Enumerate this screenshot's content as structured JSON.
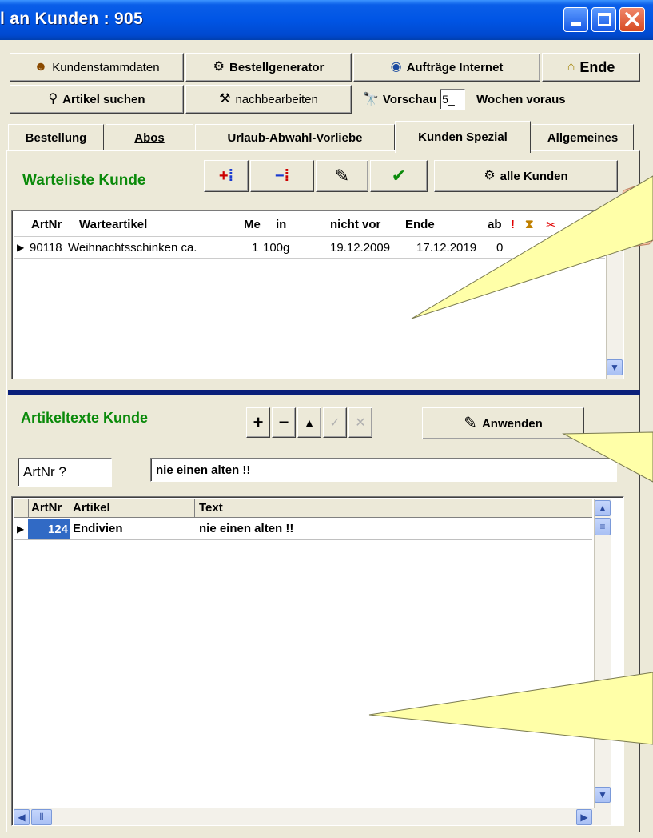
{
  "window": {
    "title": "l an Kunden :  905"
  },
  "toolbar": {
    "row1": [
      {
        "label": "Kundenstammdaten",
        "icon": "person-search-icon"
      },
      {
        "label": "Bestellgenerator",
        "icon": "gears-icon"
      },
      {
        "label": "Aufträge Internet",
        "icon": "globe-icon"
      },
      {
        "label": "Ende",
        "icon": "exit-door-icon"
      }
    ],
    "row2": [
      {
        "label": "Artikel suchen",
        "icon": "magnifier-icon"
      },
      {
        "label": "nachbearbeiten",
        "icon": "tools-icon"
      },
      {
        "label": "Vorschau",
        "icon": "binoculars-icon"
      }
    ],
    "weeks_value": "5_",
    "weeks_suffix": "Wochen voraus"
  },
  "tabs": [
    "Bestellung",
    "Abos",
    "Urlaub-Abwahl-Vorliebe",
    "Kunden Spezial",
    "Allgemeines"
  ],
  "active_tab": "Kunden Spezial",
  "warteliste": {
    "title": "Warteliste Kunde",
    "all_customers_label": "alle Kunden",
    "columns": [
      "ArtNr",
      "Warteartikel",
      "Me",
      "in",
      "nicht vor",
      "Ende",
      "ab",
      "!",
      "⧗",
      "✂"
    ],
    "rows": [
      {
        "artnr": "90118",
        "artikel": "Weihnachtsschinken ca.",
        "me": "1",
        "in": "100g",
        "nicht_vor": "19.12.2009",
        "ende": "17.12.2019",
        "ab": "0"
      }
    ]
  },
  "artikeltexte": {
    "title": "Artikeltexte Kunde",
    "apply_label": "Anwenden",
    "artnr_placeholder": "ArtNr ?",
    "text_value": "nie einen alten !!",
    "columns": [
      "ArtNr",
      "Artikel",
      "Text"
    ],
    "rows": [
      {
        "artnr": "124",
        "artikel": "Endivien",
        "text": "nie einen alten !!"
      }
    ]
  },
  "colors": {
    "accent_green": "#0a8a0a",
    "titlebar": "#0055e5",
    "separator": "#0a1f7a",
    "callout": "#ffffa8"
  }
}
